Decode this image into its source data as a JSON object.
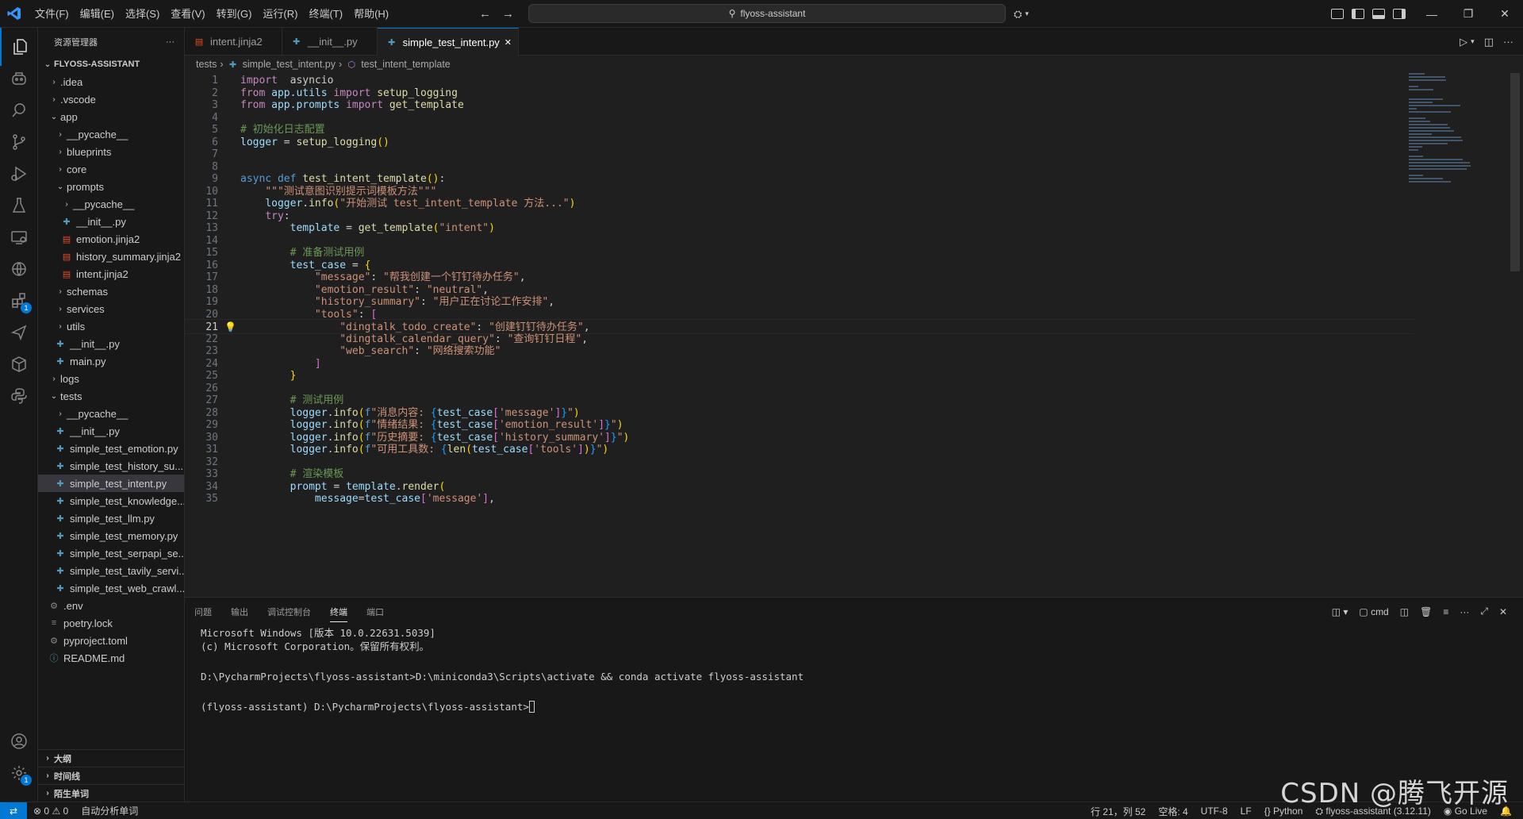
{
  "titlebar": {
    "menu": [
      "文件(F)",
      "编辑(E)",
      "选择(S)",
      "查看(V)",
      "转到(G)",
      "运行(R)",
      "终端(T)",
      "帮助(H)"
    ],
    "search_text": "flyoss-assistant"
  },
  "activity_badges": {
    "extensions": "1",
    "settings": "1"
  },
  "sidebar": {
    "title": "资源管理器",
    "more": "···",
    "root": "FLYOSS-ASSISTANT",
    "items": [
      {
        "label": ".idea",
        "depth": 0,
        "type": "folder",
        "open": false
      },
      {
        "label": ".vscode",
        "depth": 0,
        "type": "folder",
        "open": false
      },
      {
        "label": "app",
        "depth": 0,
        "type": "folder",
        "open": true
      },
      {
        "label": "__pycache__",
        "depth": 1,
        "type": "folder",
        "open": false
      },
      {
        "label": "blueprints",
        "depth": 1,
        "type": "folder",
        "open": false
      },
      {
        "label": "core",
        "depth": 1,
        "type": "folder",
        "open": false
      },
      {
        "label": "prompts",
        "depth": 1,
        "type": "folder",
        "open": true
      },
      {
        "label": "__pycache__",
        "depth": 2,
        "type": "folder",
        "open": false
      },
      {
        "label": "__init__.py",
        "depth": 2,
        "type": "py"
      },
      {
        "label": "emotion.jinja2",
        "depth": 2,
        "type": "jinja"
      },
      {
        "label": "history_summary.jinja2",
        "depth": 2,
        "type": "jinja"
      },
      {
        "label": "intent.jinja2",
        "depth": 2,
        "type": "jinja"
      },
      {
        "label": "schemas",
        "depth": 1,
        "type": "folder",
        "open": false
      },
      {
        "label": "services",
        "depth": 1,
        "type": "folder",
        "open": false
      },
      {
        "label": "utils",
        "depth": 1,
        "type": "folder",
        "open": false
      },
      {
        "label": "__init__.py",
        "depth": 1,
        "type": "py"
      },
      {
        "label": "main.py",
        "depth": 1,
        "type": "py"
      },
      {
        "label": "logs",
        "depth": 0,
        "type": "folder",
        "open": false
      },
      {
        "label": "tests",
        "depth": 0,
        "type": "folder",
        "open": true
      },
      {
        "label": "__pycache__",
        "depth": 1,
        "type": "folder",
        "open": false
      },
      {
        "label": "__init__.py",
        "depth": 1,
        "type": "py"
      },
      {
        "label": "simple_test_emotion.py",
        "depth": 1,
        "type": "py"
      },
      {
        "label": "simple_test_history_su...",
        "depth": 1,
        "type": "py"
      },
      {
        "label": "simple_test_intent.py",
        "depth": 1,
        "type": "py",
        "selected": true
      },
      {
        "label": "simple_test_knowledge...",
        "depth": 1,
        "type": "py"
      },
      {
        "label": "simple_test_llm.py",
        "depth": 1,
        "type": "py"
      },
      {
        "label": "simple_test_memory.py",
        "depth": 1,
        "type": "py"
      },
      {
        "label": "simple_test_serpapi_se...",
        "depth": 1,
        "type": "py"
      },
      {
        "label": "simple_test_tavily_servi...",
        "depth": 1,
        "type": "py"
      },
      {
        "label": "simple_test_web_crawl...",
        "depth": 1,
        "type": "py"
      },
      {
        "label": ".env",
        "depth": 0,
        "type": "gear"
      },
      {
        "label": "poetry.lock",
        "depth": 0,
        "type": "lock"
      },
      {
        "label": "pyproject.toml",
        "depth": 0,
        "type": "gear"
      },
      {
        "label": "README.md",
        "depth": 0,
        "type": "info"
      }
    ],
    "bottom_sections": [
      "大纲",
      "时间线",
      "陌生单词"
    ]
  },
  "tabs": [
    {
      "label": "intent.jinja2",
      "type": "jinja",
      "active": false
    },
    {
      "label": "__init__.py",
      "type": "py",
      "active": false
    },
    {
      "label": "simple_test_intent.py",
      "type": "py",
      "active": true
    }
  ],
  "breadcrumb": [
    "tests",
    "simple_test_intent.py",
    "test_intent_template"
  ],
  "code": {
    "current_line": 21,
    "lines": [
      [
        [
          "kc",
          "import"
        ],
        [
          "",
          "  asyncio"
        ]
      ],
      [
        [
          "kc",
          "from"
        ],
        [
          "v",
          " app.utils "
        ],
        [
          "kc",
          "import"
        ],
        [
          "f",
          " setup_logging"
        ]
      ],
      [
        [
          "kc",
          "from"
        ],
        [
          "v",
          " app.prompts "
        ],
        [
          "kc",
          "import"
        ],
        [
          "f",
          " get_template"
        ]
      ],
      [],
      [
        [
          "c",
          "# 初始化日志配置"
        ]
      ],
      [
        [
          "v",
          "logger"
        ],
        [
          "",
          " = "
        ],
        [
          "f",
          "setup_logging"
        ],
        [
          "p",
          "()"
        ]
      ],
      [],
      [],
      [
        [
          "k",
          "async def "
        ],
        [
          "f",
          "test_intent_template"
        ],
        [
          "p",
          "()"
        ],
        [
          "",
          ":"
        ]
      ],
      [
        [
          "",
          "    "
        ],
        [
          "s",
          "\"\"\"测试意图识别提示词模板方法\"\"\""
        ]
      ],
      [
        [
          "",
          "    "
        ],
        [
          "v",
          "logger"
        ],
        [
          "",
          "."
        ],
        [
          "f",
          "info"
        ],
        [
          "p",
          "("
        ],
        [
          "s",
          "\"开始测试 test_intent_template 方法...\""
        ],
        [
          "p",
          ")"
        ]
      ],
      [
        [
          "",
          "    "
        ],
        [
          "kc",
          "try"
        ],
        [
          "",
          ":"
        ]
      ],
      [
        [
          "",
          "        "
        ],
        [
          "v",
          "template"
        ],
        [
          "",
          " = "
        ],
        [
          "f",
          "get_template"
        ],
        [
          "p",
          "("
        ],
        [
          "s",
          "\"intent\""
        ],
        [
          "p",
          ")"
        ]
      ],
      [],
      [
        [
          "",
          "        "
        ],
        [
          "c",
          "# 准备测试用例"
        ]
      ],
      [
        [
          "",
          "        "
        ],
        [
          "v",
          "test_case"
        ],
        [
          "",
          " = "
        ],
        [
          "p",
          "{"
        ]
      ],
      [
        [
          "",
          "            "
        ],
        [
          "s",
          "\"message\""
        ],
        [
          "",
          ": "
        ],
        [
          "s",
          "\"帮我创建一个钉钉待办任务\""
        ],
        [
          "",
          ","
        ]
      ],
      [
        [
          "",
          "            "
        ],
        [
          "s",
          "\"emotion_result\""
        ],
        [
          "",
          ": "
        ],
        [
          "s",
          "\"neutral\""
        ],
        [
          "",
          ","
        ]
      ],
      [
        [
          "",
          "            "
        ],
        [
          "s",
          "\"history_summary\""
        ],
        [
          "",
          ": "
        ],
        [
          "s",
          "\"用户正在讨论工作安排\""
        ],
        [
          "",
          ","
        ]
      ],
      [
        [
          "",
          "            "
        ],
        [
          "s",
          "\"tools\""
        ],
        [
          "",
          ": "
        ],
        [
          "p2",
          "["
        ]
      ],
      [
        [
          "",
          "                "
        ],
        [
          "s",
          "\"dingtalk_todo_create\""
        ],
        [
          "",
          ": "
        ],
        [
          "s",
          "\"创建钉钉待办任务\""
        ],
        [
          "",
          ","
        ]
      ],
      [
        [
          "",
          "                "
        ],
        [
          "s",
          "\"dingtalk_calendar_query\""
        ],
        [
          "",
          ": "
        ],
        [
          "s",
          "\"查询钉钉日程\""
        ],
        [
          "",
          ","
        ]
      ],
      [
        [
          "",
          "                "
        ],
        [
          "s",
          "\"web_search\""
        ],
        [
          "",
          ": "
        ],
        [
          "s",
          "\"网络搜索功能\""
        ]
      ],
      [
        [
          "",
          "            "
        ],
        [
          "p2",
          "]"
        ]
      ],
      [
        [
          "",
          "        "
        ],
        [
          "p",
          "}"
        ]
      ],
      [],
      [
        [
          "",
          "        "
        ],
        [
          "c",
          "# 测试用例"
        ]
      ],
      [
        [
          "",
          "        "
        ],
        [
          "v",
          "logger"
        ],
        [
          "",
          "."
        ],
        [
          "f",
          "info"
        ],
        [
          "p",
          "("
        ],
        [
          "k",
          "f"
        ],
        [
          "s",
          "\"消息内容: "
        ],
        [
          "p3",
          "{"
        ],
        [
          "v",
          "test_case"
        ],
        [
          "p2",
          "["
        ],
        [
          "s",
          "'message'"
        ],
        [
          "p2",
          "]"
        ],
        [
          "p3",
          "}"
        ],
        [
          "s",
          "\""
        ],
        [
          "p",
          ")"
        ]
      ],
      [
        [
          "",
          "        "
        ],
        [
          "v",
          "logger"
        ],
        [
          "",
          "."
        ],
        [
          "f",
          "info"
        ],
        [
          "p",
          "("
        ],
        [
          "k",
          "f"
        ],
        [
          "s",
          "\"情绪结果: "
        ],
        [
          "p3",
          "{"
        ],
        [
          "v",
          "test_case"
        ],
        [
          "p2",
          "["
        ],
        [
          "s",
          "'emotion_result'"
        ],
        [
          "p2",
          "]"
        ],
        [
          "p3",
          "}"
        ],
        [
          "s",
          "\""
        ],
        [
          "p",
          ")"
        ]
      ],
      [
        [
          "",
          "        "
        ],
        [
          "v",
          "logger"
        ],
        [
          "",
          "."
        ],
        [
          "f",
          "info"
        ],
        [
          "p",
          "("
        ],
        [
          "k",
          "f"
        ],
        [
          "s",
          "\"历史摘要: "
        ],
        [
          "p3",
          "{"
        ],
        [
          "v",
          "test_case"
        ],
        [
          "p2",
          "["
        ],
        [
          "s",
          "'history_summary'"
        ],
        [
          "p2",
          "]"
        ],
        [
          "p3",
          "}"
        ],
        [
          "s",
          "\""
        ],
        [
          "p",
          ")"
        ]
      ],
      [
        [
          "",
          "        "
        ],
        [
          "v",
          "logger"
        ],
        [
          "",
          "."
        ],
        [
          "f",
          "info"
        ],
        [
          "p",
          "("
        ],
        [
          "k",
          "f"
        ],
        [
          "s",
          "\"可用工具数: "
        ],
        [
          "p3",
          "{"
        ],
        [
          "f",
          "len"
        ],
        [
          "p",
          "("
        ],
        [
          "v",
          "test_case"
        ],
        [
          "p2",
          "["
        ],
        [
          "s",
          "'tools'"
        ],
        [
          "p2",
          "]"
        ],
        [
          "p",
          ")"
        ],
        [
          "p3",
          "}"
        ],
        [
          "s",
          "\""
        ],
        [
          "p",
          ")"
        ]
      ],
      [],
      [
        [
          "",
          "        "
        ],
        [
          "c",
          "# 渲染模板"
        ]
      ],
      [
        [
          "",
          "        "
        ],
        [
          "v",
          "prompt"
        ],
        [
          "",
          " = "
        ],
        [
          "v",
          "template"
        ],
        [
          "",
          "."
        ],
        [
          "f",
          "render"
        ],
        [
          "p",
          "("
        ]
      ],
      [
        [
          "",
          "            "
        ],
        [
          "v",
          "message"
        ],
        [
          "",
          "="
        ],
        [
          "v",
          "test_case"
        ],
        [
          "p2",
          "["
        ],
        [
          "s",
          "'message'"
        ],
        [
          "p2",
          "]"
        ],
        [
          "",
          ","
        ]
      ]
    ]
  },
  "panel": {
    "tabs": [
      "问题",
      "输出",
      "调试控制台",
      "终端",
      "端口"
    ],
    "active_tab": "终端",
    "shell": "cmd",
    "terminal_lines": [
      "Microsoft Windows [版本 10.0.22631.5039]",
      "(c) Microsoft Corporation。保留所有权利。",
      "",
      "D:\\PycharmProjects\\flyoss-assistant>D:\\miniconda3\\Scripts\\activate && conda activate flyoss-assistant",
      "",
      "(flyoss-assistant) D:\\PycharmProjects\\flyoss-assistant>"
    ]
  },
  "statusbar": {
    "errors": "0",
    "warnings": "0",
    "spell": "自动分析单词",
    "position": "行 21，列 52",
    "indent": "空格: 4",
    "encoding": "UTF-8",
    "eol": "LF",
    "language": "Python",
    "interpreter": "flyoss-assistant (3.12.11)",
    "golive": "Go Live"
  },
  "watermark": "CSDN @腾飞开源",
  "colors": {
    "accent": "#0078d4",
    "background": "#1f1f1f",
    "sidebar": "#181818"
  }
}
